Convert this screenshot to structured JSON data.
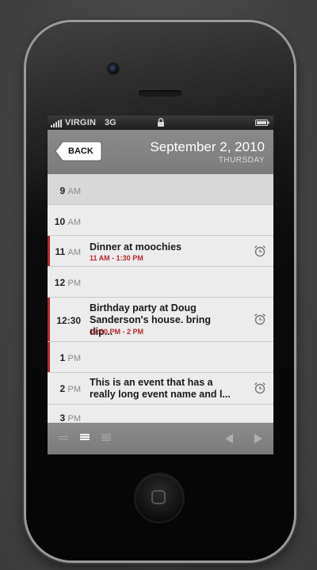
{
  "statusbar": {
    "carrier": "VIRGIN",
    "network": "3G"
  },
  "header": {
    "back_label": "BACK",
    "date": "September 2, 2010",
    "weekday": "THURSDAY"
  },
  "rows": [
    {
      "hour": "9",
      "ampm": "AM"
    },
    {
      "hour": "10",
      "ampm": "AM"
    },
    {
      "hour": "11",
      "ampm": "AM",
      "title": "Dinner at moochies",
      "range": "11 AM - 1:30 PM"
    },
    {
      "hour": "12",
      "ampm": "PM"
    },
    {
      "hour": "12:30",
      "ampm": "",
      "title_line1": "Birthday party at Doug",
      "title_line2": "Sanderson's house. bring dip...",
      "range": "12:30 PM - 2 PM"
    },
    {
      "hour": "1",
      "ampm": "PM"
    },
    {
      "hour": "2",
      "ampm": "PM",
      "title_line1": "This is an event that has a",
      "title_line2": "really long event name and l..."
    },
    {
      "hour": "3",
      "ampm": "PM"
    }
  ],
  "colors": {
    "accent": "#b8282a",
    "header": "#858585",
    "row_bg": "#ececec",
    "past_bg": "#d8d8d8"
  },
  "icons": [
    "lock-icon",
    "battery-icon",
    "signal-icon",
    "alarm-icon",
    "compact-view-icon",
    "list-view-icon",
    "detail-view-icon",
    "prev-arrow-icon",
    "next-arrow-icon"
  ]
}
